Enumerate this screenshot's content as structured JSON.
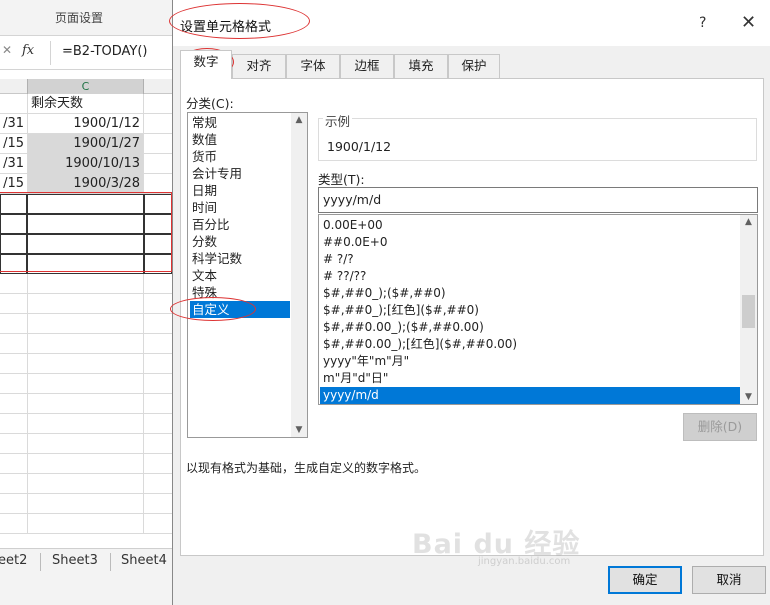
{
  "excel": {
    "ribbon_group": "页面设置",
    "formula_cancel": "✕",
    "fx_label": "fx",
    "formula": "=B2-TODAY()",
    "column_c": "C",
    "rows": [
      {
        "b": "",
        "c": "剩余天数"
      },
      {
        "b": "/31",
        "c": "1900/1/12"
      },
      {
        "b": "/15",
        "c": "1900/1/27"
      },
      {
        "b": "/31",
        "c": "1900/10/13"
      },
      {
        "b": "/15",
        "c": "1900/3/28"
      }
    ],
    "sheets": [
      "eet2",
      "Sheet3",
      "Sheet4"
    ]
  },
  "dialog": {
    "title": "设置单元格格式",
    "help": "?",
    "close": "✕",
    "tabs": [
      "数字",
      "对齐",
      "字体",
      "边框",
      "填充",
      "保护"
    ],
    "category_label": "分类(C):",
    "categories": [
      "常规",
      "数值",
      "货币",
      "会计专用",
      "日期",
      "时间",
      "百分比",
      "分数",
      "科学记数",
      "文本",
      "特殊",
      "自定义"
    ],
    "selected_category": "自定义",
    "sample_legend": "示例",
    "sample_value": "1900/1/12",
    "type_label": "类型(T):",
    "type_value": "yyyy/m/d",
    "type_items": [
      "0.00E+00",
      "##0.0E+0",
      "# ?/?",
      "# ??/??",
      "$#,##0_);($#,##0)",
      "$#,##0_);[红色]($#,##0)",
      "$#,##0.00_);($#,##0.00)",
      "$#,##0.00_);[红色]($#,##0.00)",
      "yyyy\"年\"m\"月\"",
      "m\"月\"d\"日\"",
      "yyyy/m/d"
    ],
    "selected_type": "yyyy/m/d",
    "delete_button": "删除(D)",
    "description": "以现有格式为基础，生成自定义的数字格式。",
    "ok_button": "确定",
    "cancel_button": "取消"
  },
  "watermark": {
    "text": "Bai du 经验",
    "sub": "jingyan.baidu.com"
  },
  "colors": {
    "accent": "#0078d7",
    "excel_green": "#217346",
    "annotation_red": "#d33333"
  }
}
